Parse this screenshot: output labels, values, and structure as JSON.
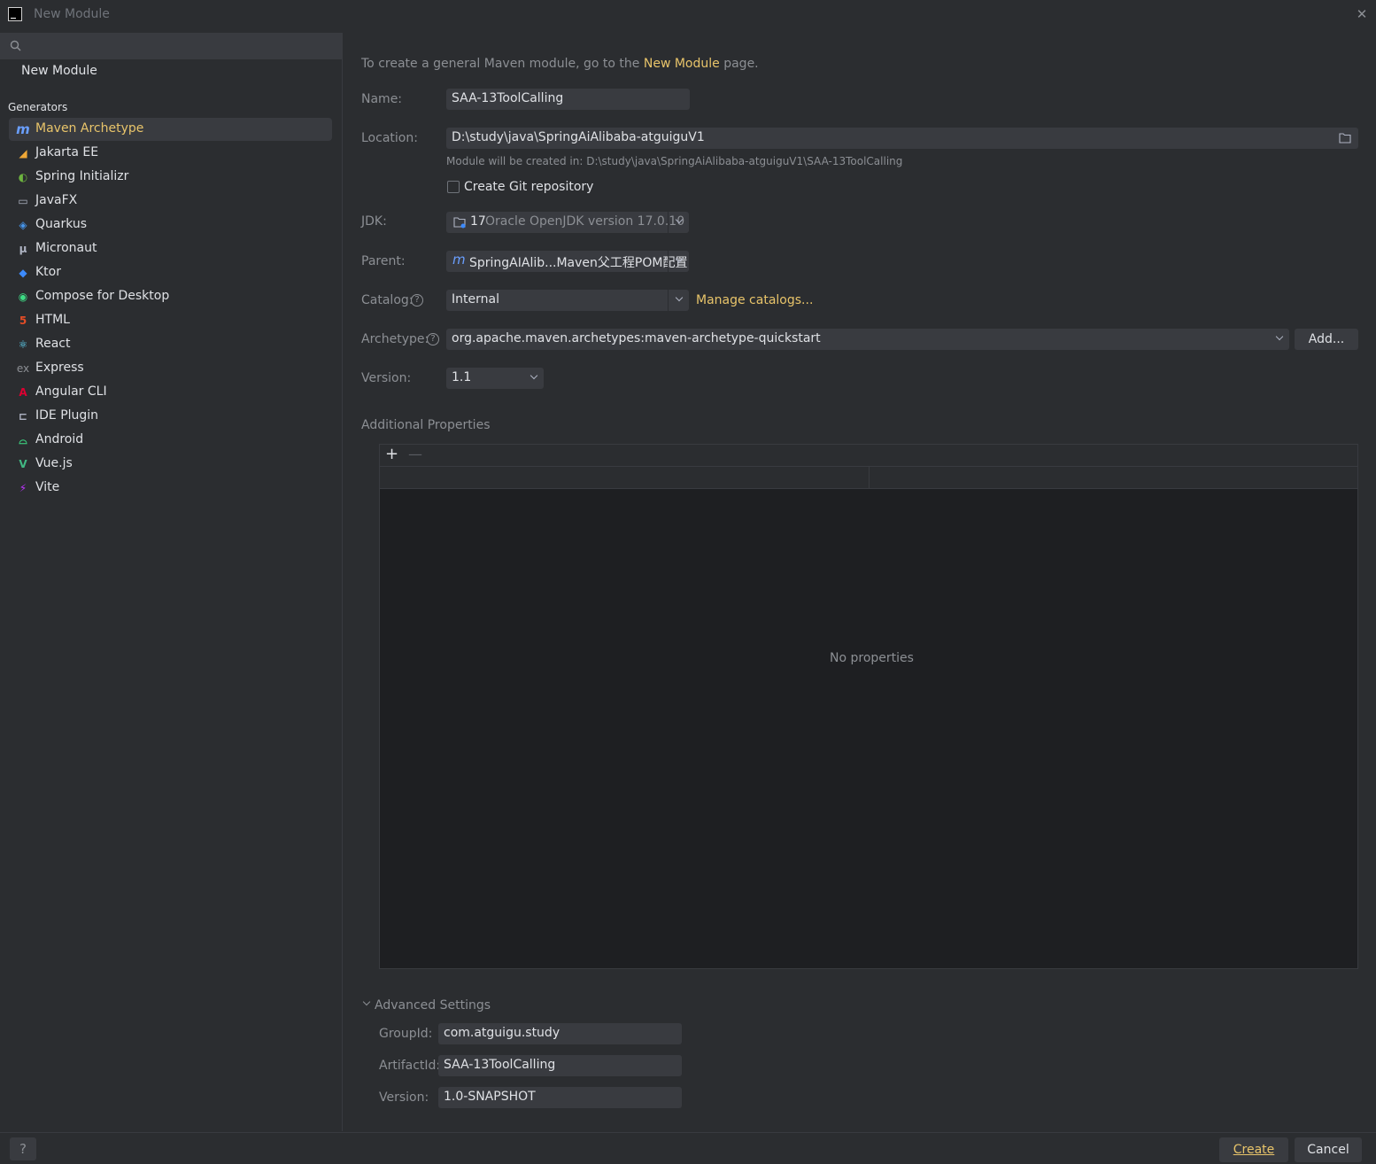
{
  "window": {
    "title": "New Module",
    "logo_text": "IJ"
  },
  "sidebar": {
    "search_placeholder": "",
    "new_module_label": "New Module",
    "generators_header": "Generators",
    "items": [
      {
        "label": "Maven Archetype",
        "icon": "maven-icon",
        "glyph": "m",
        "color": "#6a9fff",
        "selected": true
      },
      {
        "label": "Jakarta EE",
        "icon": "jakarta-ee-icon",
        "glyph": "◢",
        "color": "#f0a836",
        "selected": false
      },
      {
        "label": "Spring Initializr",
        "icon": "spring-icon",
        "glyph": "◐",
        "color": "#6db33f",
        "selected": false
      },
      {
        "label": "JavaFX",
        "icon": "javafx-icon",
        "glyph": "▭",
        "color": "#aeb3c2",
        "selected": false
      },
      {
        "label": "Quarkus",
        "icon": "quarkus-icon",
        "glyph": "◈",
        "color": "#4695eb",
        "selected": false
      },
      {
        "label": "Micronaut",
        "icon": "micronaut-icon",
        "glyph": "µ",
        "color": "#aeb3c2",
        "selected": false
      },
      {
        "label": "Ktor",
        "icon": "ktor-icon",
        "glyph": "◆",
        "color": "#3d8bfd",
        "selected": false
      },
      {
        "label": "Compose for Desktop",
        "icon": "compose-icon",
        "glyph": "◉",
        "color": "#3ddc84",
        "selected": false
      },
      {
        "label": "HTML",
        "icon": "html-icon",
        "glyph": "5",
        "color": "#e44d26",
        "selected": false
      },
      {
        "label": "React",
        "icon": "react-icon",
        "glyph": "⚛",
        "color": "#61dafb",
        "selected": false
      },
      {
        "label": "Express",
        "icon": "express-icon",
        "glyph": "ex",
        "color": "#8c8f94",
        "selected": false
      },
      {
        "label": "Angular CLI",
        "icon": "angular-icon",
        "glyph": "A",
        "color": "#dd0031",
        "selected": false
      },
      {
        "label": "IDE Plugin",
        "icon": "plugin-icon",
        "glyph": "⊏",
        "color": "#aeb3c2",
        "selected": false
      },
      {
        "label": "Android",
        "icon": "android-icon",
        "glyph": "⌓",
        "color": "#3ddc84",
        "selected": false
      },
      {
        "label": "Vue.js",
        "icon": "vue-icon",
        "glyph": "V",
        "color": "#41b883",
        "selected": false
      },
      {
        "label": "Vite",
        "icon": "vite-icon",
        "glyph": "⚡",
        "color": "#bd34fe",
        "selected": false
      }
    ]
  },
  "form": {
    "intro_prefix": "To create a general Maven module, go to the",
    "intro_link": "New Module",
    "intro_suffix": "page.",
    "name_label": "Name:",
    "name_value": "SAA-13ToolCalling",
    "location_label": "Location:",
    "location_value": "D:\\study\\java\\SpringAiAlibaba-atguiguV1",
    "location_hint": "Module will be created in: D:\\study\\java\\SpringAiAlibaba-atguiguV1\\SAA-13ToolCalling",
    "git_label": "Create Git repository",
    "git_checked": false,
    "jdk_label": "JDK:",
    "jdk_version": "17",
    "jdk_name": "Oracle OpenJDK version 17.0.10",
    "parent_label": "Parent:",
    "parent_value": "SpringAIAlib...Maven父工程POM配置",
    "catalog_label": "Catalog:",
    "catalog_value": "Internal",
    "manage_catalogs": "Manage catalogs...",
    "archetype_label": "Archetype:",
    "archetype_value": "org.apache.maven.archetypes:maven-archetype-quickstart",
    "add_button": "Add...",
    "version_label": "Version:",
    "version_value": "1.1"
  },
  "additional_properties": {
    "title": "Additional Properties",
    "add_symbol": "+",
    "remove_symbol": "—",
    "empty_text": "No properties"
  },
  "advanced": {
    "title": "Advanced Settings",
    "groupid_label": "GroupId:",
    "groupid_value": "com.atguigu.study",
    "artifactid_label": "ArtifactId:",
    "artifactid_value": "SAA-13ToolCalling",
    "version_label": "Version:",
    "version_value": "1.0-SNAPSHOT"
  },
  "footer": {
    "help": "?",
    "create": "Create",
    "cancel": "Cancel"
  },
  "colors": {
    "background": "#2b2d30",
    "field": "#393b40",
    "accent": "#e8c46a",
    "muted_text": "#8c8f94",
    "text": "#dfe1e5"
  }
}
